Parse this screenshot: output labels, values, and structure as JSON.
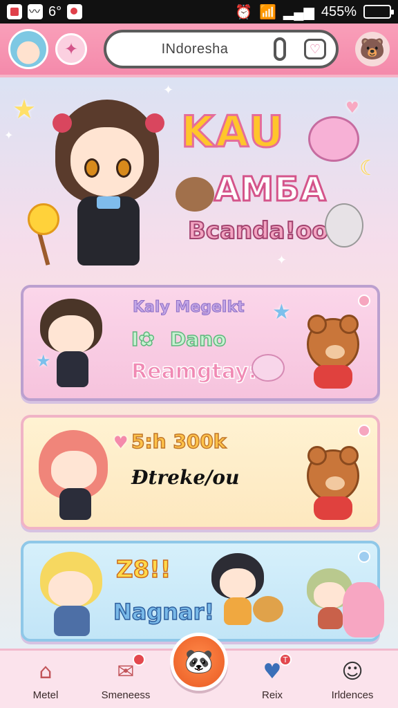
{
  "status_bar": {
    "left_temp": "6°",
    "battery": "455%",
    "icons": [
      "calendar-icon",
      "voicemail-icon",
      "tag-icon",
      "alarm-icon",
      "wifi-icon",
      "signal-icon",
      "battery-icon"
    ],
    "battery_color": "#3ec43e"
  },
  "header": {
    "search_text": "INdoresha",
    "buttons": [
      "avatar",
      "sparkle-icon",
      "mic-icon",
      "heart-icon",
      "animal-face-icon"
    ]
  },
  "banner": {
    "title_line_1": "KAU",
    "title_line_2": "AMБA",
    "title_line_3": "Bcanda!ooo"
  },
  "cards": [
    {
      "line_1": "Kaly Megelkt",
      "line_2": "Dano",
      "line_3": "Reamgtay:-"
    },
    {
      "line_1": "5:h 300k",
      "line_2": "Đtreke/ou"
    },
    {
      "line_1": "Z8!!",
      "line_2": "Nagnar!"
    }
  ],
  "bottom_nav": {
    "items": [
      {
        "label": "Metel",
        "icon": "home-icon"
      },
      {
        "label": "Smeneess",
        "icon": "mail-icon",
        "badge": ""
      },
      {
        "label": "",
        "icon": "center-panda-icon"
      },
      {
        "label": "Reix",
        "icon": "heart-shield-icon",
        "badge": "T"
      },
      {
        "label": "Irldences",
        "icon": "profile-icon"
      }
    ]
  },
  "colors": {
    "header_pink": "#f48aab",
    "accent_orange": "#e95a22",
    "card1_bg": "#fbd6ea",
    "card2_bg": "#fff2d2",
    "card3_bg": "#d6f0fb"
  }
}
